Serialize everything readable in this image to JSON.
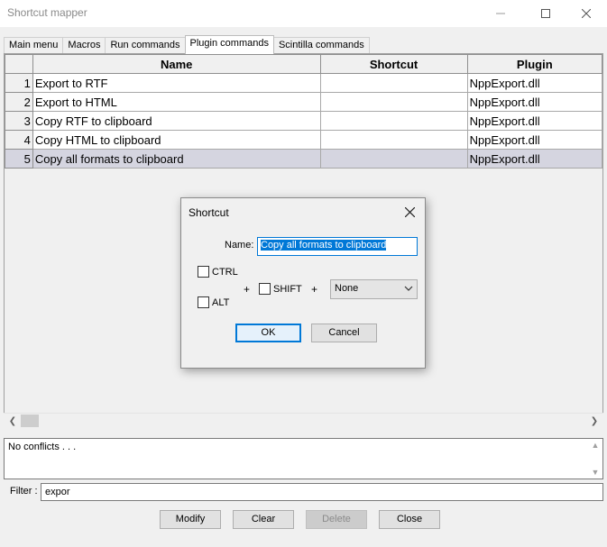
{
  "window": {
    "title": "Shortcut mapper"
  },
  "tabs": [
    {
      "label": "Main menu",
      "active": false
    },
    {
      "label": "Macros",
      "active": false
    },
    {
      "label": "Run commands",
      "active": false
    },
    {
      "label": "Plugin commands",
      "active": true
    },
    {
      "label": "Scintilla commands",
      "active": false
    }
  ],
  "grid": {
    "columns": [
      "Name",
      "Shortcut",
      "Plugin"
    ],
    "rows": [
      {
        "num": "1",
        "name": "Export to RTF",
        "shortcut": "",
        "plugin": "NppExport.dll"
      },
      {
        "num": "2",
        "name": "Export to HTML",
        "shortcut": "",
        "plugin": "NppExport.dll"
      },
      {
        "num": "3",
        "name": "Copy RTF to clipboard",
        "shortcut": "",
        "plugin": "NppExport.dll"
      },
      {
        "num": "4",
        "name": "Copy HTML to clipboard",
        "shortcut": "",
        "plugin": "NppExport.dll"
      },
      {
        "num": "5",
        "name": "Copy all formats to clipboard",
        "shortcut": "",
        "plugin": "NppExport.dll"
      }
    ],
    "selected_row": 5
  },
  "conflicts": {
    "text": "No conflicts . . ."
  },
  "filter": {
    "label": "Filter :",
    "value": "expor"
  },
  "buttons": {
    "modify": "Modify",
    "clear": "Clear",
    "delete": "Delete",
    "close": "Close"
  },
  "dialog": {
    "title": "Shortcut",
    "name_label": "Name:",
    "name_value": "Copy all formats to clipboard",
    "ctrl_label": "CTRL",
    "alt_label": "ALT",
    "shift_label": "SHIFT",
    "plus": "+",
    "key_value": "None",
    "ok_label": "OK",
    "cancel_label": "Cancel"
  }
}
